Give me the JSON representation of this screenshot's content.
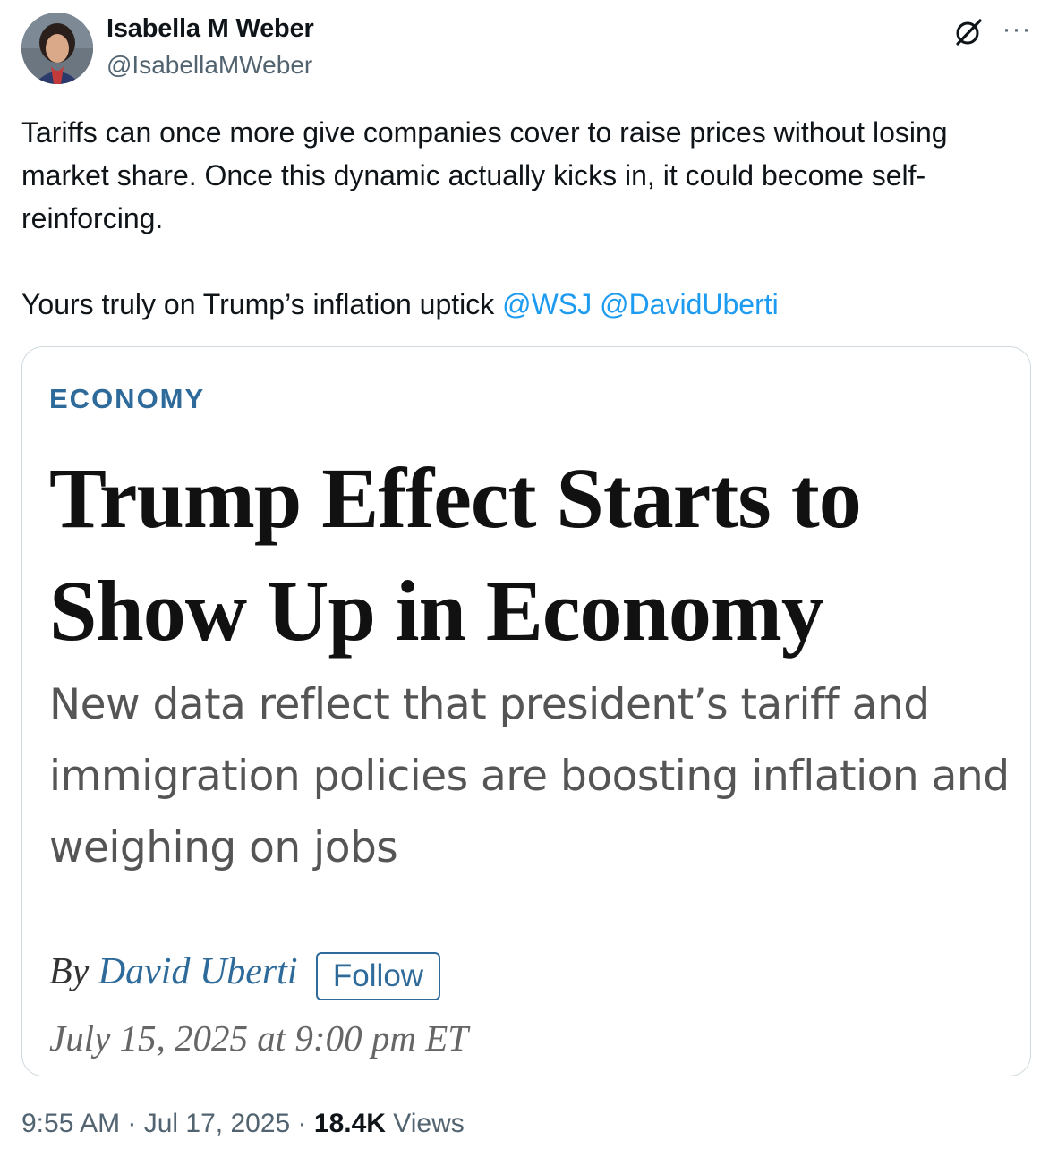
{
  "author": {
    "display_name": "Isabella M Weber",
    "handle": "@IsabellaMWeber"
  },
  "icons": {
    "grok": "grok-icon",
    "more": "more-icon",
    "more_glyph": "···"
  },
  "tweet": {
    "paragraph1": "Tariffs can once more give companies cover to raise prices without losing market share. Once this dynamic actually kicks in, it could become self-reinforcing.",
    "paragraph2_text": "Yours truly on Trump’s inflation uptick ",
    "mention1": "@WSJ",
    "mention2": "@DavidUberti"
  },
  "card": {
    "section": "ECONOMY",
    "headline": "Trump Effect Starts to Show Up in Economy",
    "dek": "New data reflect that president’s tariff and immigration policies are boosting inflation and weighing on jobs",
    "by_prefix": "By ",
    "author": "David Uberti",
    "follow_label": "Follow",
    "date": "July 15, 2025 at 9:00 pm ET"
  },
  "meta": {
    "time": "9:55 AM",
    "separator": " · ",
    "date": "Jul 17, 2025",
    "views_count": "18.4K",
    "views_label": "Views"
  },
  "colors": {
    "link": "#1d9bf0",
    "wsj_blue": "#2f6b9a",
    "muted": "#536471",
    "border": "#cfd9de"
  }
}
